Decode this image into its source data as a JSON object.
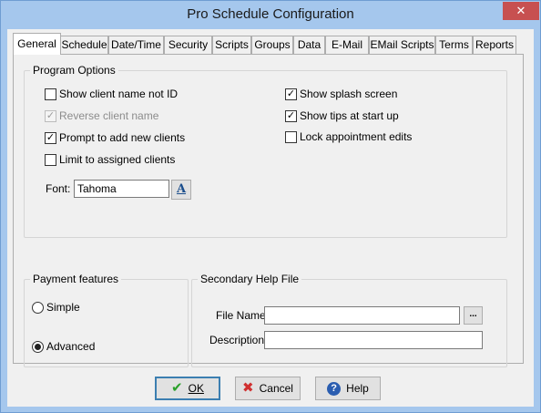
{
  "window": {
    "title": "Pro Schedule Configuration",
    "close_glyph": "✕"
  },
  "tabs": [
    {
      "label": "General",
      "active": true
    },
    {
      "label": "Schedule"
    },
    {
      "label": "Date/Time"
    },
    {
      "label": "Security"
    },
    {
      "label": "Scripts"
    },
    {
      "label": "Groups"
    },
    {
      "label": "Data"
    },
    {
      "label": "E-Mail"
    },
    {
      "label": "EMail Scripts"
    },
    {
      "label": "Terms"
    },
    {
      "label": "Reports"
    }
  ],
  "program_options": {
    "title": "Program Options",
    "left": [
      {
        "label": "Show client name not ID",
        "checked": false,
        "enabled": true
      },
      {
        "label": "Reverse client name",
        "checked": true,
        "enabled": false
      },
      {
        "label": "Prompt to add new clients",
        "checked": true,
        "enabled": true
      },
      {
        "label": "Limit to assigned clients",
        "checked": false,
        "enabled": true
      }
    ],
    "right": [
      {
        "label": "Show splash screen",
        "checked": true,
        "enabled": true
      },
      {
        "label": "Show tips at start up",
        "checked": true,
        "enabled": true
      },
      {
        "label": "Lock appointment edits",
        "checked": false,
        "enabled": true
      }
    ],
    "font_label": "Font:",
    "font_value": "Tahoma",
    "font_button_icon": "font-picker-icon",
    "font_button_glyph": "A"
  },
  "payment": {
    "title": "Payment features",
    "options": [
      {
        "label": "Simple",
        "selected": false
      },
      {
        "label": "Advanced",
        "selected": true
      }
    ]
  },
  "help_file": {
    "title": "Secondary Help File",
    "file_name_label": "File Name:",
    "file_name_value": "",
    "browse_label": "...",
    "description_label": "Description:",
    "description_value": ""
  },
  "buttons": {
    "ok": {
      "label": "OK",
      "icon": "check-icon",
      "glyph": "✔",
      "color": "#2aa12a"
    },
    "cancel": {
      "label": "Cancel",
      "icon": "cross-icon",
      "glyph": "✖",
      "color": "#d03030"
    },
    "help": {
      "label": "Help",
      "icon": "help-icon",
      "glyph": "?",
      "color": "#2a5db0"
    }
  }
}
